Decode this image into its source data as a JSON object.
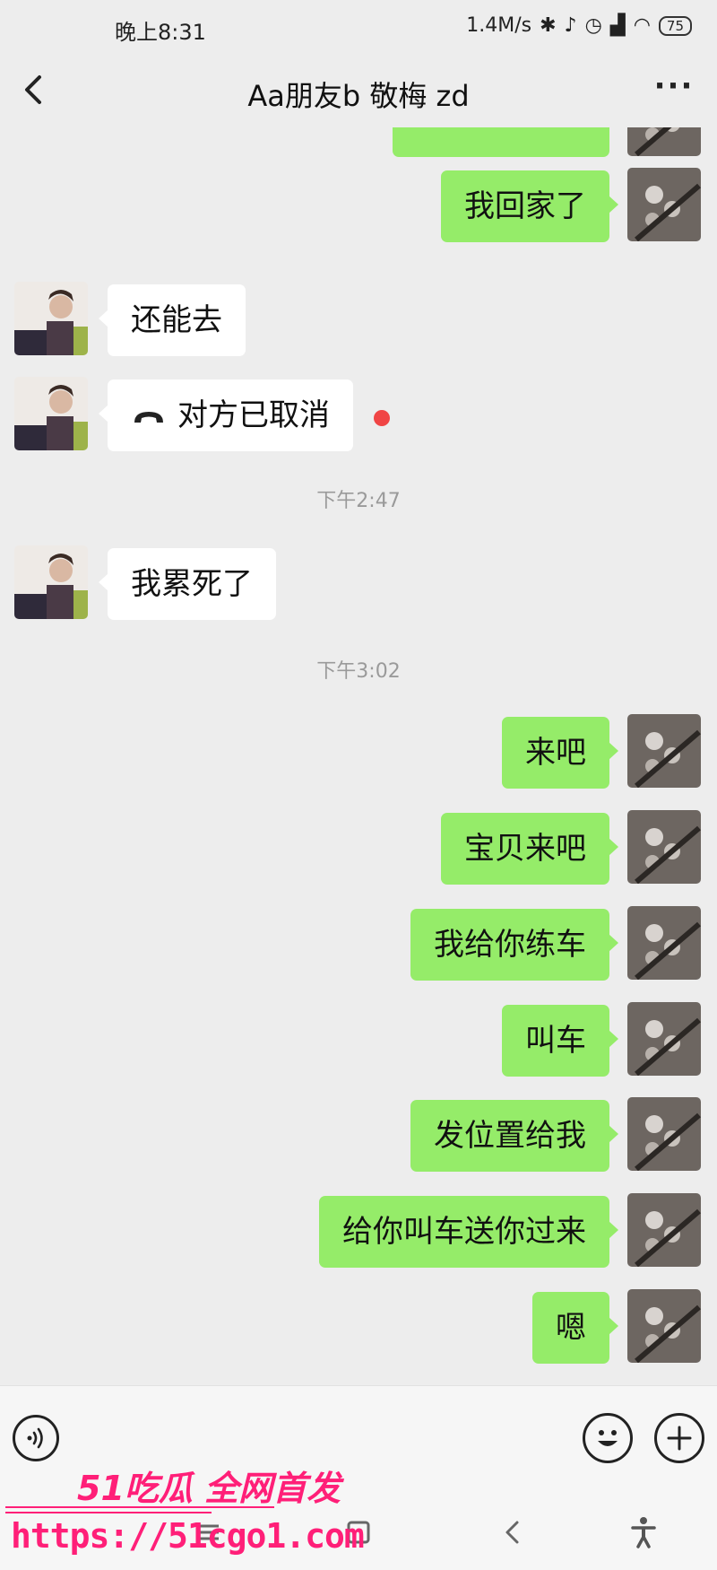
{
  "status_bar": {
    "time": "晚上8:31",
    "speed": "1.4M/s",
    "battery": "75",
    "icons": [
      "bluetooth-icon",
      "mute-icon",
      "alarm-icon",
      "signal-icon",
      "wifi-icon",
      "battery-icon"
    ]
  },
  "header": {
    "back_icon": "back-arrow-icon",
    "title": "Aa朋友b 敬梅 zd",
    "more_icon": "more-icon"
  },
  "conversation": {
    "messages": [
      {
        "side": "right",
        "text": "我回家了"
      },
      {
        "side": "left",
        "text": "还能去"
      },
      {
        "side": "left",
        "type": "call",
        "text": "对方已取消",
        "unread": true
      },
      {
        "side": "time",
        "text": "下午2:47"
      },
      {
        "side": "left",
        "text": "我累死了"
      },
      {
        "side": "time",
        "text": "下午3:02"
      },
      {
        "side": "right",
        "text": "来吧"
      },
      {
        "side": "right",
        "text": "宝贝来吧"
      },
      {
        "side": "right",
        "text": "我给你练车"
      },
      {
        "side": "right",
        "text": "叫车"
      },
      {
        "side": "right",
        "text": "发位置给我"
      },
      {
        "side": "right",
        "text": "给你叫车送你过来"
      },
      {
        "side": "right",
        "text": "嗯"
      }
    ]
  },
  "input_bar": {
    "voice_icon": "voice-icon",
    "value": "",
    "emoji_icon": "emoji-icon",
    "add_icon": "plus-icon"
  },
  "nav_bar": {
    "icons": [
      "menu-icon",
      "home-icon",
      "back-icon",
      "accessibility-icon"
    ]
  },
  "watermark": {
    "brand": "51吃瓜 全网首发",
    "url": "https://51cgo1.com"
  },
  "colors": {
    "background": "#ededed",
    "outgoing_bubble": "#95ec69",
    "incoming_bubble": "#ffffff",
    "unread_dot": "#f04545",
    "watermark": "#ff1f78"
  }
}
